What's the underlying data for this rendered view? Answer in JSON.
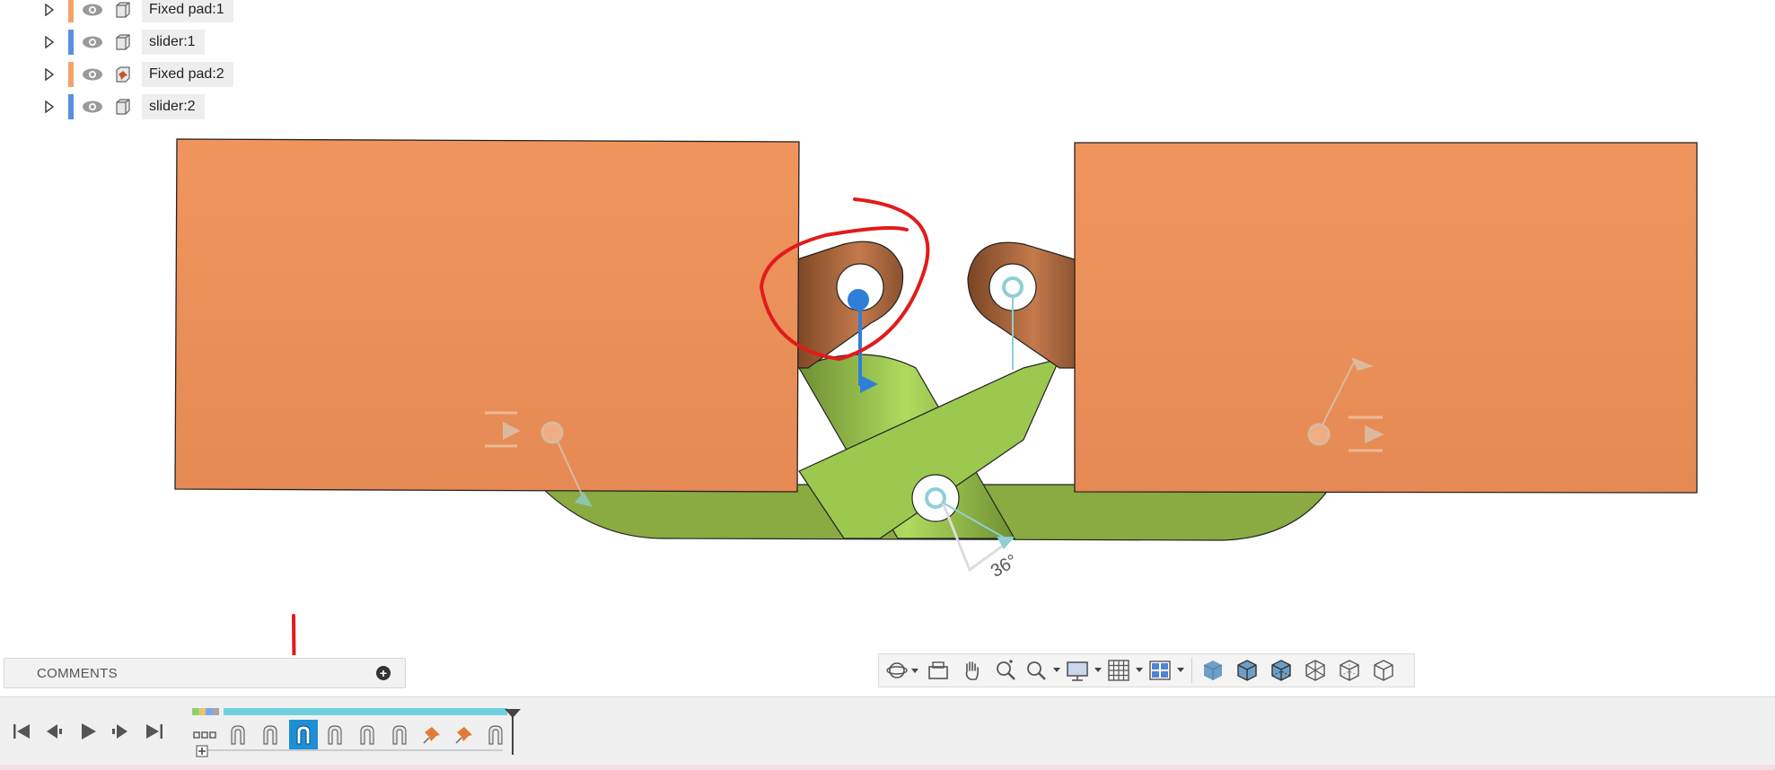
{
  "browser": {
    "items": [
      {
        "label": "Fixed pad:1",
        "color": "#f4a26a",
        "icon": "component-icon"
      },
      {
        "label": "slider:1",
        "color": "#5b8fde",
        "icon": "component-icon"
      },
      {
        "label": "Fixed pad:2",
        "color": "#f4a26a",
        "icon": "component-pinned-icon"
      },
      {
        "label": "slider:2",
        "color": "#5b8fde",
        "icon": "component-icon"
      }
    ]
  },
  "viewport": {
    "angle_label": "36°",
    "pad_color": "#f0935c",
    "slider_color": "#9cc84f",
    "annotation_color": "#e11b1b"
  },
  "comments": {
    "title": "COMMENTS",
    "add_label": "+"
  },
  "navbar": {
    "tools": [
      "orbit-icon",
      "look-at-icon",
      "pan-icon",
      "zoom-icon",
      "fit-icon",
      "display-settings-icon",
      "grid-icon",
      "viewports-icon",
      "shaded-icon",
      "shaded-edges-icon",
      "shaded-hidden-edges-icon",
      "wireframe-icon",
      "wireframe-hidden-icon",
      "wireframe-visible-icon"
    ]
  },
  "timeline": {
    "controls": [
      "skip-start-icon",
      "step-back-icon",
      "play-icon",
      "step-forward-icon",
      "skip-end-icon"
    ],
    "active_index": 2,
    "features": [
      "joint-icon",
      "joint-icon",
      "joint-icon",
      "joint-icon",
      "joint-icon",
      "joint-icon",
      "ground-pin-icon",
      "ground-pin-icon",
      "joint-icon"
    ]
  }
}
